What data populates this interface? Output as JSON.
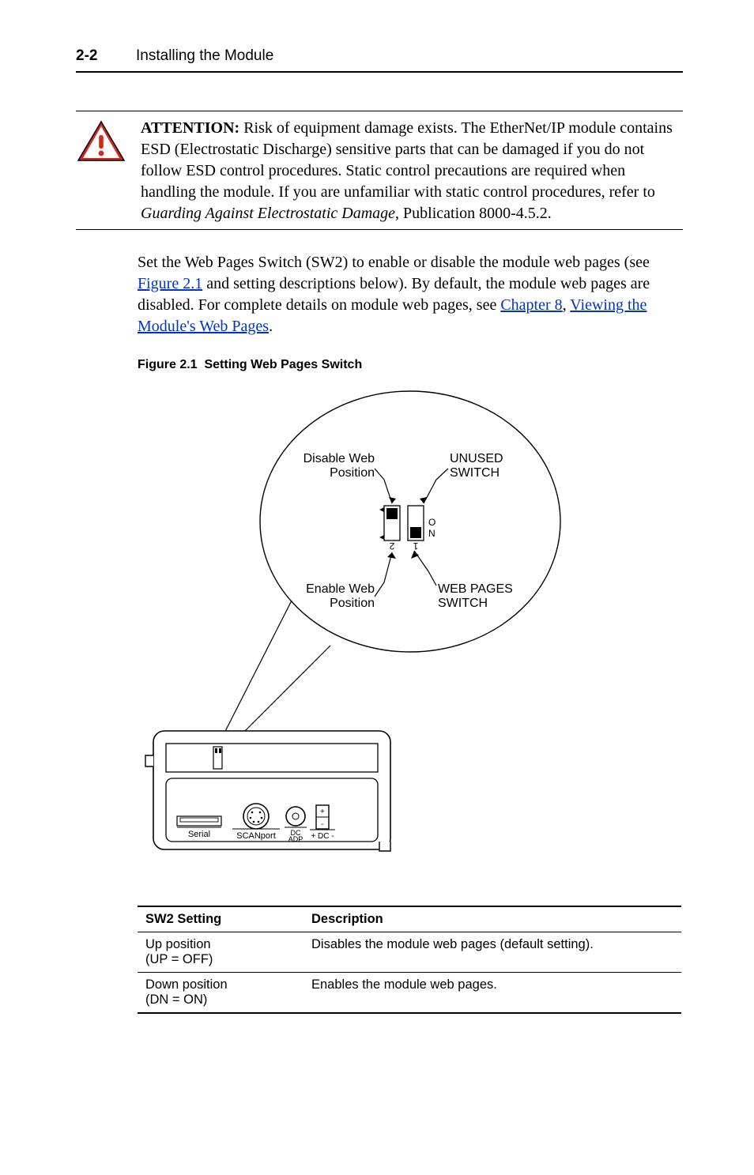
{
  "header": {
    "page_number": "2-2",
    "title": "Installing the Module"
  },
  "attention": {
    "label": "ATTENTION:",
    "text_after_label": "Risk of equipment damage exists. The EtherNet/IP module contains ESD (Electrostatic Discharge) sensitive parts that can be damaged if you do not follow ESD control procedures. Static control precautions are required when handling the module. If you are unfamiliar with static control procedures, refer to ",
    "italic": "Guarding Against Electrostatic Damage",
    "text_after_italic": ", Publication 8000-4.5.2."
  },
  "body": {
    "p1_a": "Set the Web Pages Switch (SW2) to enable or disable the module web pages (see ",
    "p1_link1": "Figure 2.1",
    "p1_b": " and setting descriptions below). By default, the module web pages are disabled. For complete details on module web pages, see ",
    "p1_link2": "Chapter 8",
    "p1_c": ", ",
    "p1_link3": "Viewing the Module's Web Pages",
    "p1_d": "."
  },
  "figure": {
    "caption_prefix": "Figure 2.1",
    "caption_title": "Setting Web Pages Switch",
    "labels": {
      "disable_web": "Disable Web",
      "position": "Position",
      "unused": "UNUSED",
      "switch": "SWITCH",
      "enable_web": "Enable Web",
      "web_pages": "WEB PAGES",
      "dip_o": "O",
      "dip_n": "N",
      "dip_1": "1",
      "dip_2": "2",
      "serial": "Serial",
      "scanport": "SCANport",
      "dc_adp": "DC\nADP",
      "dc": "+ DC -"
    }
  },
  "table": {
    "headers": {
      "setting": "SW2 Setting",
      "desc": "Description"
    },
    "rows": [
      {
        "setting_line1": "Up position",
        "setting_line2": "(UP = OFF)",
        "desc": "Disables the module web pages (default setting)."
      },
      {
        "setting_line1": "Down position",
        "setting_line2": "(DN = ON)",
        "desc": "Enables the module web pages."
      }
    ]
  }
}
